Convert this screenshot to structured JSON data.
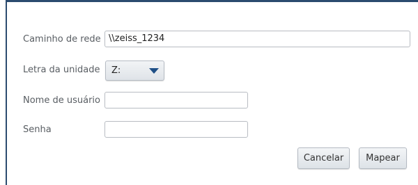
{
  "form": {
    "network_path": {
      "label": "Caminho de rede",
      "value": "\\\\zeiss_1234"
    },
    "drive_letter": {
      "label": "Letra da unidade",
      "value": "Z:"
    },
    "username": {
      "label": "Nome de usuário",
      "value": ""
    },
    "password": {
      "label": "Senha",
      "value": ""
    }
  },
  "buttons": {
    "cancel": "Cancelar",
    "map": "Mapear"
  },
  "icons": {
    "dropdown": "caret-down-icon"
  },
  "colors": {
    "frame_border": "#2b4b6f",
    "caret": "#1f4f86"
  }
}
